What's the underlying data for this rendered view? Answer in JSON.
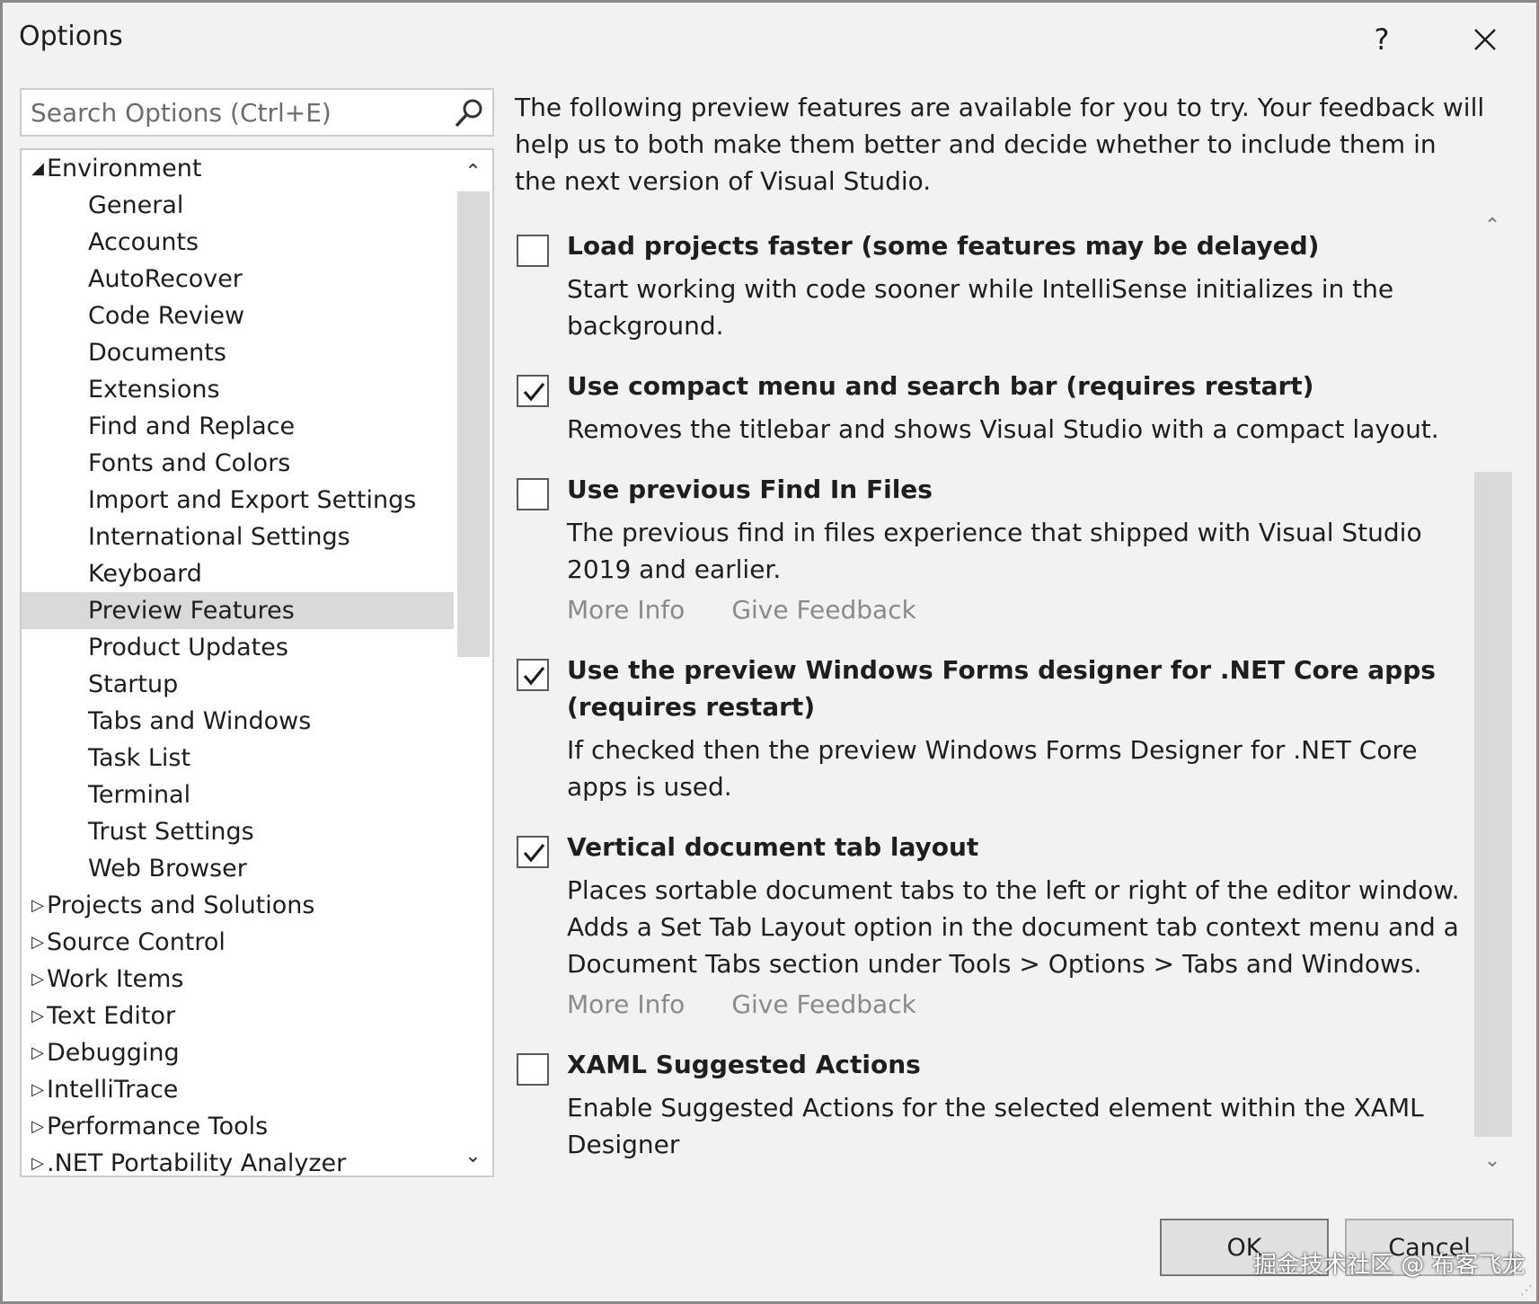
{
  "dialog": {
    "title": "Options",
    "help_label": "?",
    "close_label": "✕"
  },
  "search": {
    "placeholder": "Search Options (Ctrl+E)"
  },
  "tree": {
    "environment": {
      "label": "Environment",
      "children": [
        "General",
        "Accounts",
        "AutoRecover",
        "Code Review",
        "Documents",
        "Extensions",
        "Find and Replace",
        "Fonts and Colors",
        "Import and Export Settings",
        "International Settings",
        "Keyboard",
        "Preview Features",
        "Product Updates",
        "Startup",
        "Tabs and Windows",
        "Task List",
        "Terminal",
        "Trust Settings",
        "Web Browser"
      ],
      "selected": "Preview Features"
    },
    "collapsed": [
      "Projects and Solutions",
      "Source Control",
      "Work Items",
      "Text Editor",
      "Debugging",
      "IntelliTrace",
      "Performance Tools",
      ".NET Portability Analyzer"
    ]
  },
  "intro": "The following preview features are available for you to try. Your feedback will help us to both make them better and decide whether to include them in the next version of Visual Studio.",
  "features": [
    {
      "title": "Load projects faster (some features may be delayed)",
      "description": "Start working with code sooner while IntelliSense initializes in the background.",
      "checked": false,
      "more_info": "",
      "give_feedback": ""
    },
    {
      "title": "Use compact menu and search bar (requires restart)",
      "description": "Removes the titlebar and shows Visual Studio with a compact layout.",
      "checked": true,
      "more_info": "",
      "give_feedback": ""
    },
    {
      "title": "Use previous Find In Files",
      "description": "The previous find in files experience that shipped with Visual Studio 2019 and earlier.",
      "checked": false,
      "more_info": "More Info",
      "give_feedback": "Give Feedback"
    },
    {
      "title": "Use the preview Windows Forms designer for .NET Core apps (requires restart)",
      "description": "If checked then the preview Windows Forms Designer for .NET Core apps is used.",
      "checked": true,
      "more_info": "",
      "give_feedback": ""
    },
    {
      "title": "Vertical document tab layout",
      "description": "Places sortable document tabs to the left or right of the editor window. Adds a Set Tab Layout option in the document tab context menu and a Document Tabs section under Tools > Options > Tabs and Windows.",
      "checked": true,
      "more_info": "More Info",
      "give_feedback": "Give Feedback"
    },
    {
      "title": "XAML Suggested Actions",
      "description": "Enable Suggested Actions for the selected element within the XAML Designer",
      "checked": false,
      "more_info": "",
      "give_feedback": ""
    }
  ],
  "footer": {
    "ok_label": "OK",
    "cancel_label": "Cancel",
    "watermark": "掘金技术社区 @ 布客飞龙"
  },
  "colors": {
    "dialog_bg": "#f2f2f2",
    "selected_bg": "#d9d9d9",
    "link_gray": "#8a8a8a"
  }
}
